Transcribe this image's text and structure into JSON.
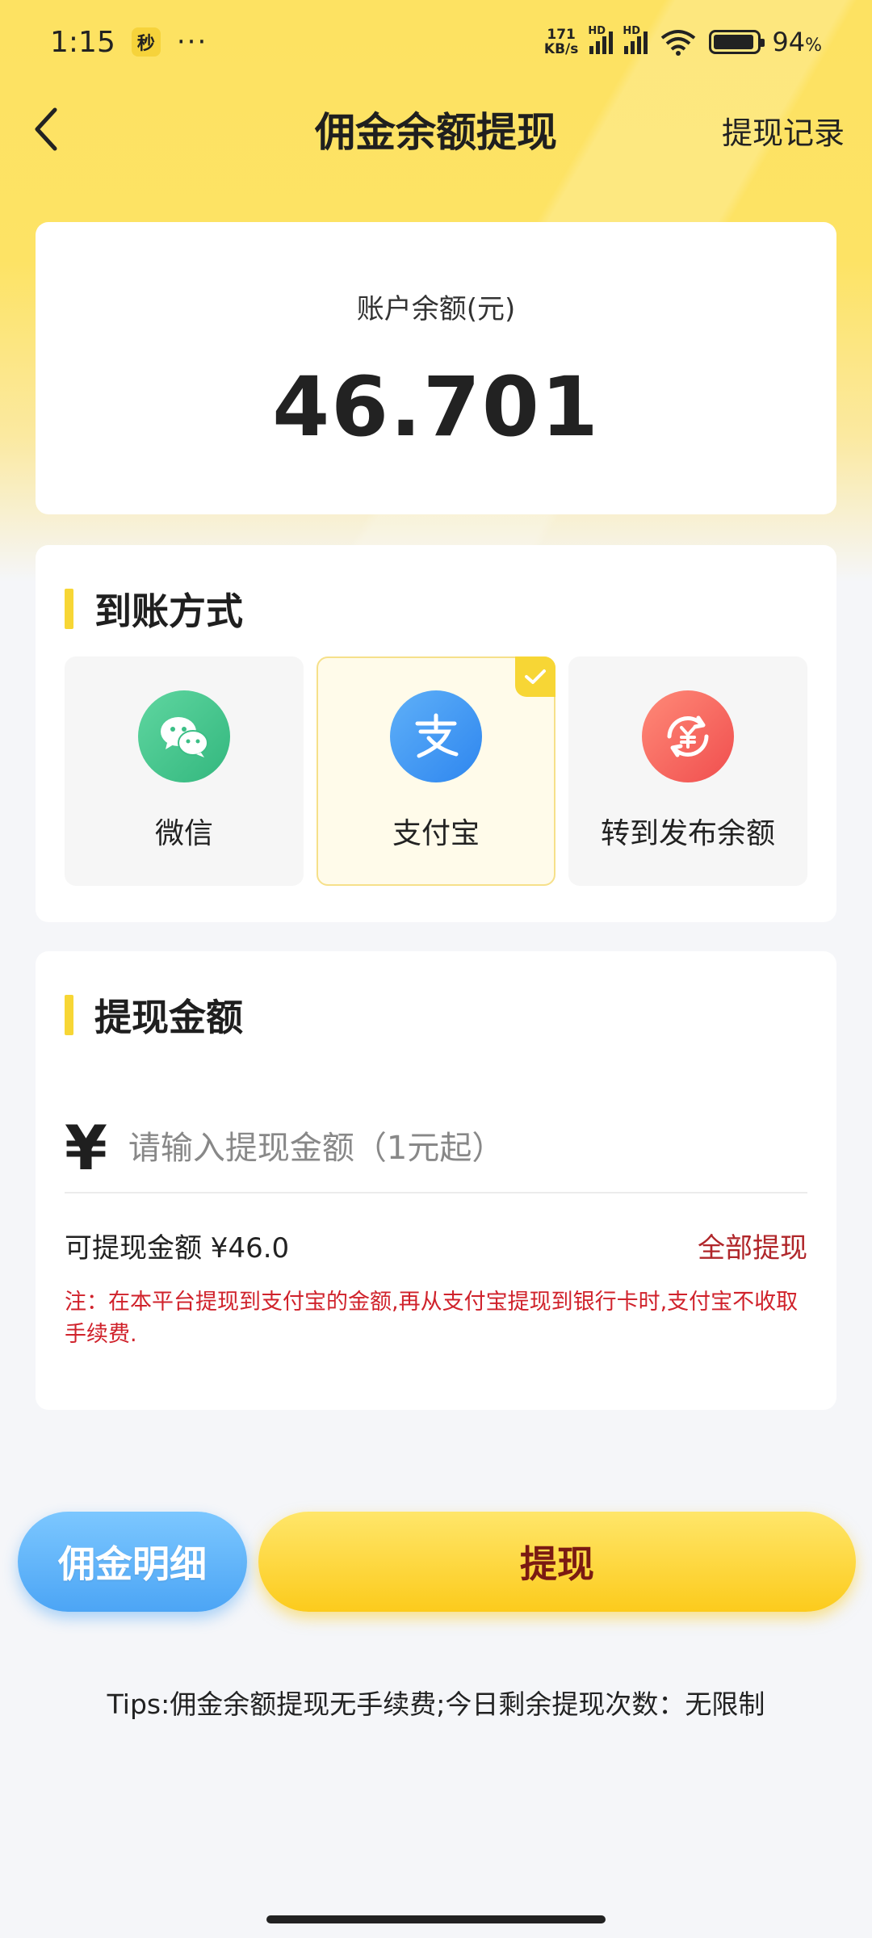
{
  "status_bar": {
    "time": "1:15",
    "app_badge": "秒",
    "dots": "···",
    "net_speed_value": "171",
    "net_speed_unit": "KB/s",
    "signal_label_1": "HD",
    "signal_label_2": "HD",
    "battery_percent": "94",
    "battery_unit": "%"
  },
  "nav": {
    "title": "佣金余额提现",
    "action": "提现记录"
  },
  "balance": {
    "label": "账户余额(元)",
    "value": "46.701"
  },
  "method_section": {
    "title": "到账方式",
    "options": [
      {
        "label": "微信",
        "icon": "wechat-icon",
        "selected": false
      },
      {
        "label": "支付宝",
        "icon": "alipay-icon",
        "selected": true
      },
      {
        "label": "转到发布余额",
        "icon": "transfer-balance-icon",
        "selected": false
      }
    ]
  },
  "amount_section": {
    "title": "提现金额",
    "currency": "¥",
    "input_value": "",
    "input_placeholder": "请输入提现金额（1元起）",
    "available_text": "可提现金额 ¥46.0",
    "withdraw_all": "全部提现",
    "note": "注：在本平台提现到支付宝的金额,再从支付宝提现到银行卡时,支付宝不收取手续费."
  },
  "buttons": {
    "detail": "佣金明细",
    "withdraw": "提现"
  },
  "tips": "Tips:佣金余额提现无手续费;今日剩余提现次数：无限制",
  "colors": {
    "accent_yellow": "#f7d635",
    "note_red": "#d0222b",
    "withdraw_all_red": "#b0262a",
    "detail_blue": "#4ca5f5"
  }
}
